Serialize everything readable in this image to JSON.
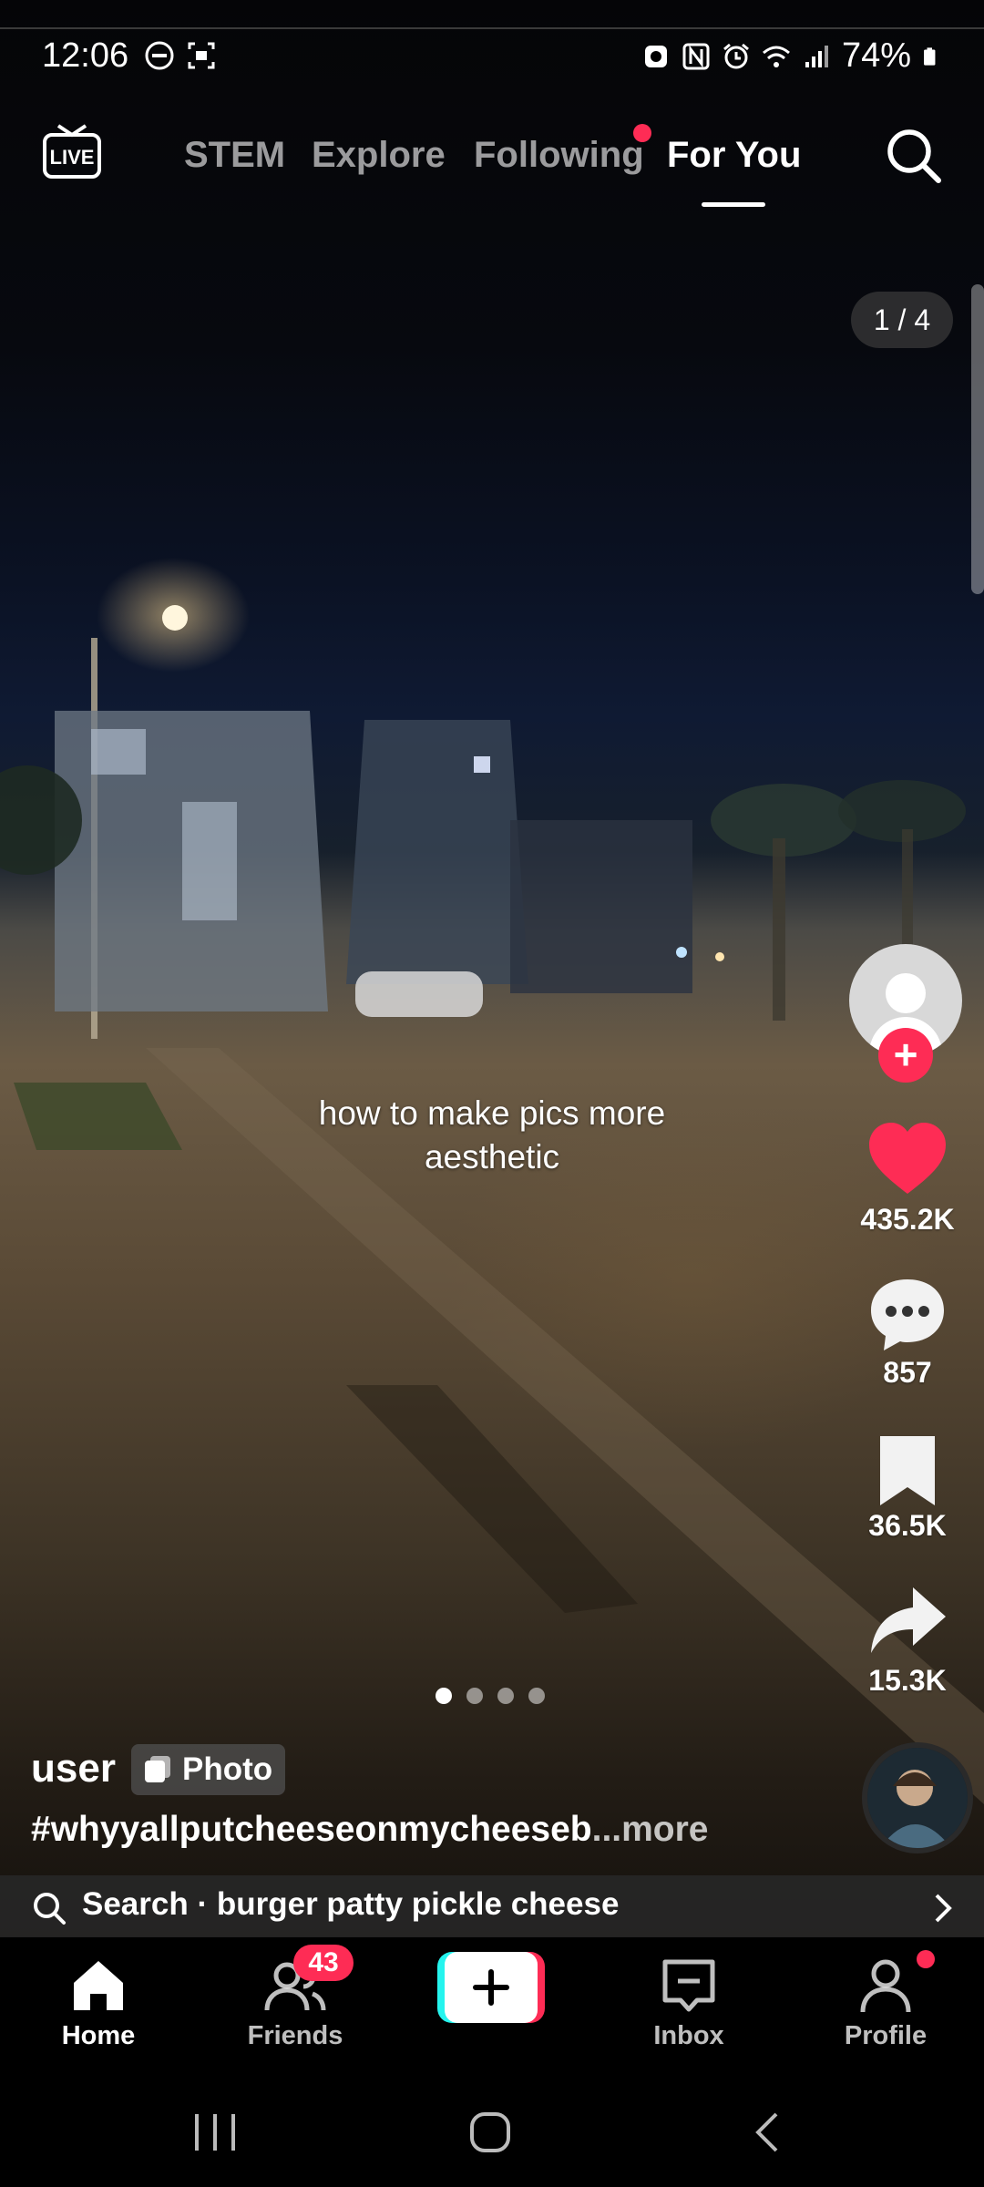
{
  "status_bar": {
    "time": "12:06",
    "battery": "74%"
  },
  "header": {
    "tabs": [
      {
        "label": "STEM"
      },
      {
        "label": "Explore"
      },
      {
        "label": "Following"
      },
      {
        "label": "For You"
      }
    ],
    "active_tab": "For You"
  },
  "post": {
    "page_counter": "1 / 4",
    "caption_overlay": "how to make pics more aesthetic",
    "username": "user",
    "media_badge": "Photo",
    "description": "#whyyallputcheeseonmycheeseb",
    "more_label": "...more",
    "carousel": {
      "total": 4,
      "current": 1
    }
  },
  "actions": {
    "likes": "435.2K",
    "comments": "857",
    "saves": "36.5K",
    "shares": "15.3K"
  },
  "search_suggestion": "Search · burger patty pickle cheese",
  "bottom_nav": {
    "home": "Home",
    "friends": "Friends",
    "friends_badge": "43",
    "inbox": "Inbox",
    "profile": "Profile"
  },
  "colors": {
    "accent": "#fe2c55",
    "create_left": "#25f4ee",
    "create_right": "#fe2c55"
  },
  "icons": [
    "live-icon",
    "search-icon",
    "heart-icon",
    "comment-icon",
    "bookmark-icon",
    "share-icon",
    "home-icon",
    "friends-icon",
    "plus-icon",
    "inbox-icon",
    "profile-icon"
  ]
}
